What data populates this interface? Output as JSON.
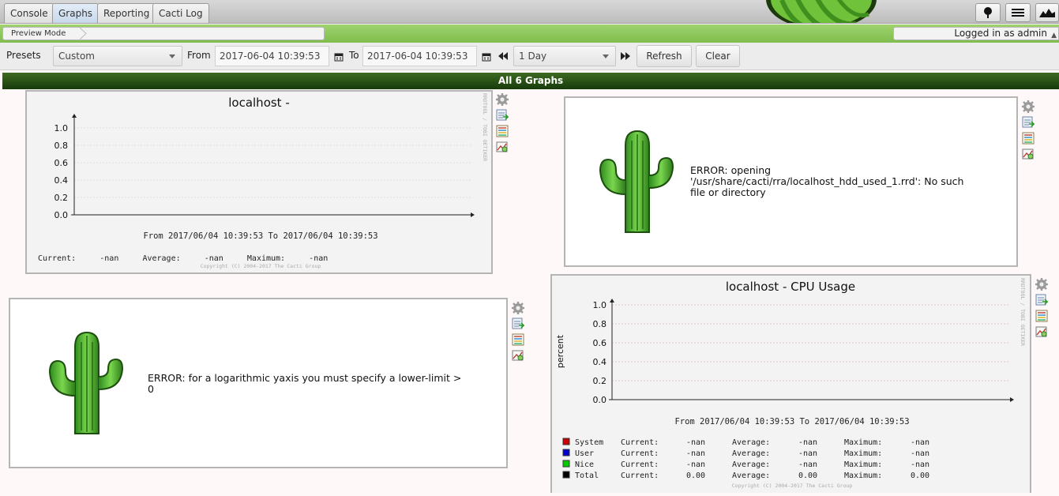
{
  "tabs": [
    "Console",
    "Graphs",
    "Reporting",
    "Cacti Log"
  ],
  "active_tab": "Graphs",
  "breadcrumb": "Preview Mode",
  "login_text": "Logged in as admin",
  "filter": {
    "presets_label": "Presets",
    "preset_value": "Custom",
    "from_label": "From",
    "from_value": "2017-06-04 10:39:53",
    "to_label": "To",
    "to_value": "2017-06-04 10:39:53",
    "timespan_value": "1 Day",
    "refresh_label": "Refresh",
    "clear_label": "Clear"
  },
  "header_title": "All 6 Graphs",
  "graph1": {
    "title": "localhost -",
    "yticks": [
      "1.0",
      "0.8",
      "0.6",
      "0.4",
      "0.2",
      "0.0"
    ],
    "range_text": "From 2017/06/04 10:39:53 To 2017/06/04 10:39:53",
    "stats_text": "Current:     -nan     Average:     -nan     Maximum:     -nan",
    "copyright": "Copyright (C) 2004-2017 The Cacti Group",
    "watermark": "RRDTOOL / TOBI OETIKER"
  },
  "graph2": {
    "error_text": "ERROR: opening '/usr/share/cacti/rra/localhost_hdd_used_1.rrd': No such file or directory"
  },
  "graph3": {
    "error_text": "ERROR: for a logarithmic yaxis you must specify a lower-limit > 0"
  },
  "graph4": {
    "title": "localhost - CPU Usage",
    "ylabel": "percent",
    "yticks": [
      "1.0",
      "0.8",
      "0.6",
      "0.4",
      "0.2",
      "0.0"
    ],
    "range_text": "From 2017/06/04 10:39:53 To 2017/06/04 10:39:53",
    "copyright": "Copyright (C) 2004-2017 The Cacti Group",
    "watermark": "RRDTOOL / TOBI OETIKER",
    "legend": [
      {
        "name": "System",
        "color": "#cc0000",
        "current": "-nan",
        "average": "-nan",
        "maximum": "-nan"
      },
      {
        "name": "User",
        "color": "#0000cc",
        "current": "-nan",
        "average": "-nan",
        "maximum": "-nan"
      },
      {
        "name": "Nice",
        "color": "#00cc00",
        "current": "-nan",
        "average": "-nan",
        "maximum": "-nan"
      },
      {
        "name": "Total",
        "color": "#000000",
        "current": "0.00",
        "average": "0.00",
        "maximum": "0.00"
      }
    ],
    "labels": {
      "current": "Current:",
      "average": "Average:",
      "maximum": "Maximum:"
    }
  }
}
